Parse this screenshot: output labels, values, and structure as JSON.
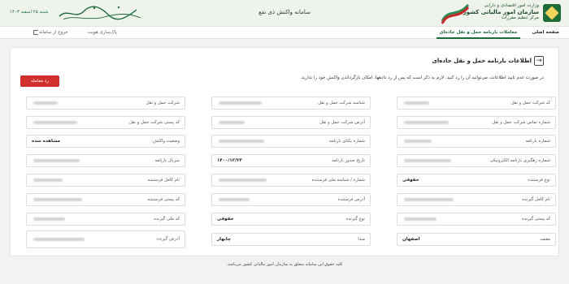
{
  "header": {
    "org_lines": [
      "وزارت امور اقتصادی و دارایی",
      "سازمان امور مالیاتی کشور",
      "مرکز تنظیم مقررات"
    ],
    "title": "سامانه واکنش ذی نفع",
    "date": "شنبه ۲۵ اسفند ۱۴۰۳",
    "colors": {
      "brand": "#1d6b36",
      "header_bg": "#eef3ec"
    }
  },
  "nav": {
    "home": "صفحه اصلی",
    "active_tab": "معاملات بارنامه حمل و نقل جاده‌ای",
    "auth": "پاک‌سازی هویت",
    "exit": "خروج از سامانه"
  },
  "page": {
    "title": "اطلاعات بارنامه حمل و نقل جاده‌ای",
    "notice": "در صورت عدم تایید اطلاعات، می‌توانید آن را رد کنید. لازم به ذکر است که پس از رد دادهها، امکان بازگرداندن واکنش خود را ندارید.",
    "cancel_button": "رد معامله",
    "accent_red": "#d32f2f"
  },
  "fields": [
    {
      "label": "شرکت حمل و نقل",
      "value": ""
    },
    {
      "label": "شناسه شرکت حمل و نقل",
      "value": ""
    },
    {
      "label": "کد شرکت حمل و نقل",
      "value": ""
    },
    {
      "label": "کد پستی شرکت حمل و نقل",
      "value": ""
    },
    {
      "label": "آدرس شرکت حمل و نقل",
      "value": ""
    },
    {
      "label": "شماره تماس شرکت حمل و نقل",
      "value": ""
    },
    {
      "label": "وضعیت واکنش",
      "value": "مشاهده شده"
    },
    {
      "label": "شماره یکتای بارنامه",
      "value": ""
    },
    {
      "label": "شماره بارنامه",
      "value": ""
    },
    {
      "label": "سریال بارنامه",
      "value": ""
    },
    {
      "label": "تاریخ صدور بارنامه",
      "value": "۱۴۰۰/۱۲/۲۳"
    },
    {
      "label": "شماره رهگیری بارنامه الکترونیکی",
      "value": ""
    },
    {
      "label": "نام کامل فرستنده",
      "value": ""
    },
    {
      "label": "شماره / شناسه ملی فرستنده",
      "value": ""
    },
    {
      "label": "نوع فرستنده",
      "value": "حقوقی"
    },
    {
      "label": "کد پستی فرستنده",
      "value": ""
    },
    {
      "label": "آدرس فرستنده",
      "value": ""
    },
    {
      "label": "نام کامل گیرنده",
      "value": ""
    },
    {
      "label": "کد ملی گیرنده",
      "value": ""
    },
    {
      "label": "نوع گیرنده",
      "value": "حقوقی"
    },
    {
      "label": "کد پستی گیرنده",
      "value": ""
    },
    {
      "label": "آدرس گیرنده",
      "value": ""
    },
    {
      "label": "مبدا",
      "value": "چابهار"
    },
    {
      "label": "مقصد",
      "value": "اصفهان"
    }
  ],
  "footer": "کلیه حقوق این سامانه متعلق به سازمان امور مالیاتی کشور می‌باشد."
}
